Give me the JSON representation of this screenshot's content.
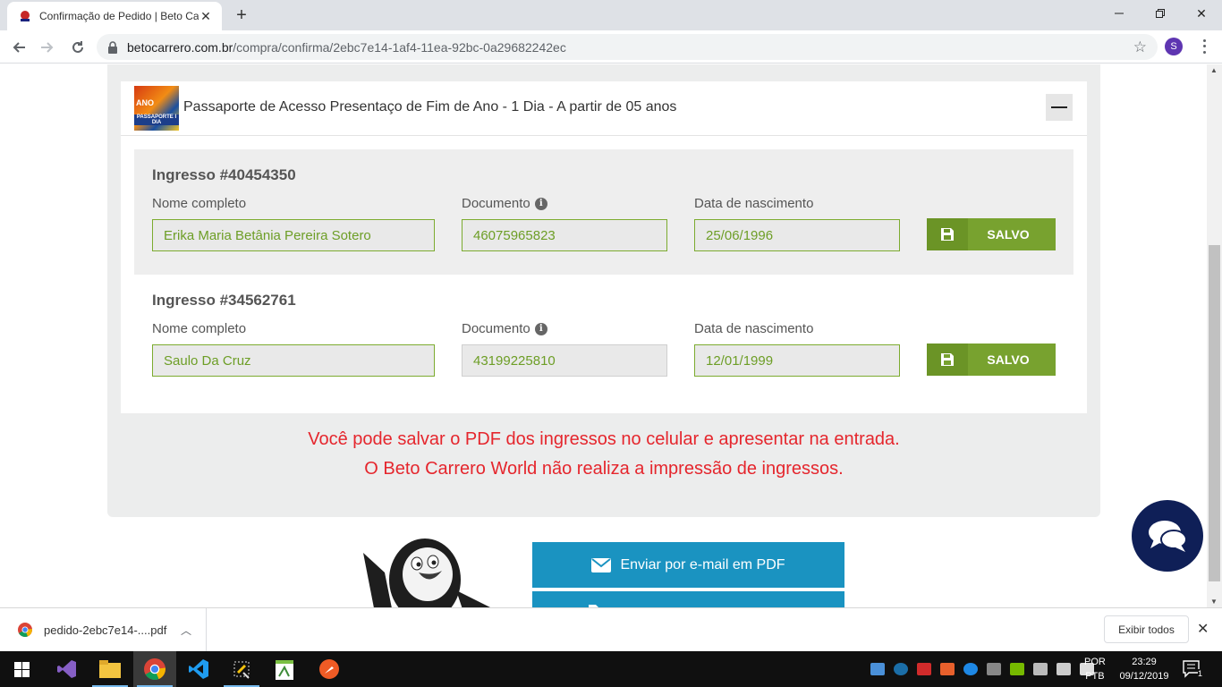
{
  "browser": {
    "tab_title": "Confirmação de Pedido | Beto Ca",
    "url_host": "betocarrero.com.br",
    "url_path": "/compra/confirma/2ebc7e14-1af4-11ea-92bc-0a29682242ec",
    "profile_initial": "S"
  },
  "product": {
    "title": "Passaporte de Acesso Presentaço de Fim de Ano - 1 Dia - A partir de 05 anos",
    "thumb_text_top": "ANO",
    "thumb_text_bottom": "PASSAPORTE I DIA"
  },
  "labels": {
    "name": "Nome completo",
    "document": "Documento",
    "birth": "Data de nascimento",
    "saved": "SALVO",
    "info_glyph": "i"
  },
  "tickets": [
    {
      "title": "Ingresso #40454350",
      "name": "Erika Maria Betânia Pereira Sotero",
      "document": "46075965823",
      "birth": "25/06/1996"
    },
    {
      "title": "Ingresso #34562761",
      "name": "Saulo Da Cruz",
      "document": "43199225810",
      "birth": "12/01/1999"
    }
  ],
  "notice": {
    "line1": "Você pode salvar o PDF dos ingressos no celular e apresentar na entrada.",
    "line2": "O Beto Carrero World não realiza a impressão de ingressos."
  },
  "actions": {
    "email_pdf": "Enviar por e-mail em PDF"
  },
  "downloads": {
    "file_name": "pedido-2ebc7e14-....pdf",
    "show_all": "Exibir todos"
  },
  "taskbar": {
    "lang_top": "POR",
    "lang_bottom": "PTB",
    "time": "23:29",
    "date": "09/12/2019",
    "notification_count": "1"
  },
  "colors": {
    "accent_green": "#78a22f",
    "accent_blue": "#1a93c1",
    "notice_red": "#e5262d",
    "chat_navy": "#0f1f57"
  }
}
